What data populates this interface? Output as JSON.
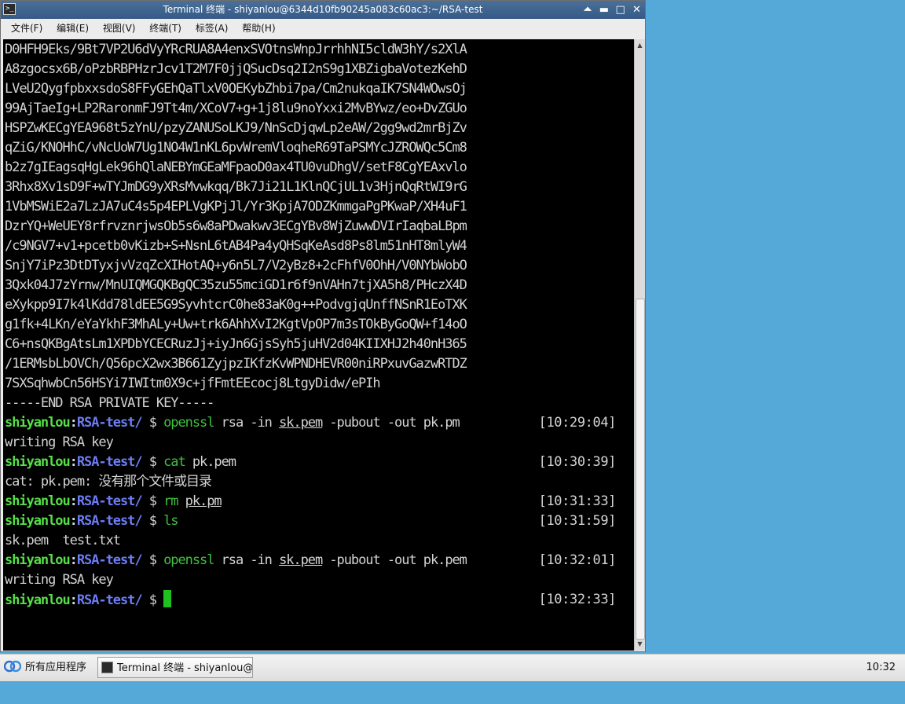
{
  "window": {
    "title": "Terminal 终端 - shiyanlou@6344d10fb90245a083c60ac3:~/RSA-test",
    "app_icon": "terminal-icon",
    "buttons": {
      "maximize_glyph": "⏶",
      "minimize_glyph": "▬",
      "restore_glyph": "□",
      "close_glyph": "✕"
    }
  },
  "menu": [
    "文件(F)",
    "编辑(E)",
    "视图(V)",
    "终端(T)",
    "标签(A)",
    "帮助(H)"
  ],
  "terminal": {
    "key_lines": [
      "D0HFH9Eks/9Bt7VP2U6dVyYRcRUA8A4enxSVOtnsWnpJrrhhNI5cldW3hY/s2XlA",
      "A8zgocsx6B/oPzbRBPHzrJcv1T2M7F0jjQSucDsq2I2nS9g1XBZigbaVotezKehD",
      "LVeU2QygfpbxxsdoS8FFyGEhQaTlxV0OEKybZhbi7pa/Cm2nukqaIK7SN4WOwsOj",
      "99AjTaeIg+LP2RaronmFJ9Tt4m/XCoV7+g+1j8lu9noYxxi2MvBYwz/eo+DvZGUo",
      "HSPZwKECgYEA968t5zYnU/pzyZANUSoLKJ9/NnScDjqwLp2eAW/2gg9wd2mrBjZv",
      "qZiG/KNOHhC/vNcUoW7Ug1NO4W1nKL6pvWremVloqheR69TaPSMYcJZROWQc5Cm8",
      "b2z7gIEagsqHgLek96hQlaNEBYmGEaMFpaoD0ax4TU0vuDhgV/setF8CgYEAxvlo",
      "3Rhx8Xv1sD9F+wTYJmDG9yXRsMvwkqq/Bk7Ji21L1KlnQCjUL1v3HjnQqRtWI9rG",
      "1VbMSWiE2a7LzJA7uC4s5p4EPLVgKPjJl/Yr3KpjA7ODZKmmgaPgPKwaP/XH4uF1",
      "DzrYQ+WeUEY8rfrvznrjwsOb5s6w8aPDwakwv3ECgYBv8WjZuwwDVIrIaqbaLBpm",
      "/c9NGV7+v1+pcetb0vKizb+S+NsnL6tAB4Pa4yQHSqKeAsd8Ps8lm51nHT8mlyW4",
      "SnjY7iPz3DtDTyxjvVzqZcXIHotAQ+y6n5L7/V2yBz8+2cFhfV0OhH/V0NYbWobO",
      "3Qxk04J7zYrnw/MnUIQMGQKBgQC35zu55mciGD1r6f9nVAHn7tjXA5h8/PHczX4D",
      "eXykpp9I7k4lKdd78ldEE5G9SyvhtcrC0he83aK0g++PodvgjqUnffNSnR1EoTXK",
      "g1fk+4LKn/eYaYkhF3MhALy+Uw+trk6AhhXvI2KgtVpOP7m3sTOkByGoQW+f14oO",
      "C6+nsQKBgAtsLm1XPDbYCECRuzJj+iyJn6GjsSyh5juHV2d04KIIXHJ2h40nH365",
      "/1ERMsbLbOVCh/Q56pcX2wx3B661ZyjpzIKfzKvWPNDHEVR00niRPxuvGazwRTDZ",
      "7SXSqhwbCn56HSYi7IWItm0X9c+jfFmtEEcocj8LtgyDidw/ePIh",
      "-----END RSA PRIVATE KEY-----"
    ],
    "prompt": {
      "user": "shiyanlou",
      "colon": ":",
      "dir": "RSA-test/",
      "sign": " $ "
    },
    "entries": [
      {
        "cmd": "openssl",
        "arg1": " rsa -in ",
        "file": "sk.pem",
        "arg2": " -pubout -out pk.pm",
        "time": "[10:29:04]",
        "out": "writing RSA key"
      },
      {
        "cmd": "cat",
        "arg1": " pk.pem",
        "file": "",
        "arg2": "",
        "time": "[10:30:39]",
        "out": "cat: pk.pem: 没有那个文件或目录"
      },
      {
        "cmd": "rm",
        "arg1": " ",
        "file": "pk.pm",
        "arg2": "",
        "time": "[10:31:33]",
        "out": ""
      },
      {
        "cmd": "ls",
        "arg1": "",
        "file": "",
        "arg2": "",
        "time": "[10:31:59]",
        "out": "sk.pem  test.txt"
      },
      {
        "cmd": "openssl",
        "arg1": " rsa -in ",
        "file": "sk.pem",
        "arg2": " -pubout -out pk.pem",
        "time": "[10:32:01]",
        "out": "writing RSA key"
      }
    ],
    "last_time": "[10:32:33]"
  },
  "taskbar": {
    "start_label": "所有应用程序",
    "start_icon": "apps-logo-icon",
    "task_label": "Terminal 终端 - shiyanlou@···",
    "clock": "10:32"
  }
}
